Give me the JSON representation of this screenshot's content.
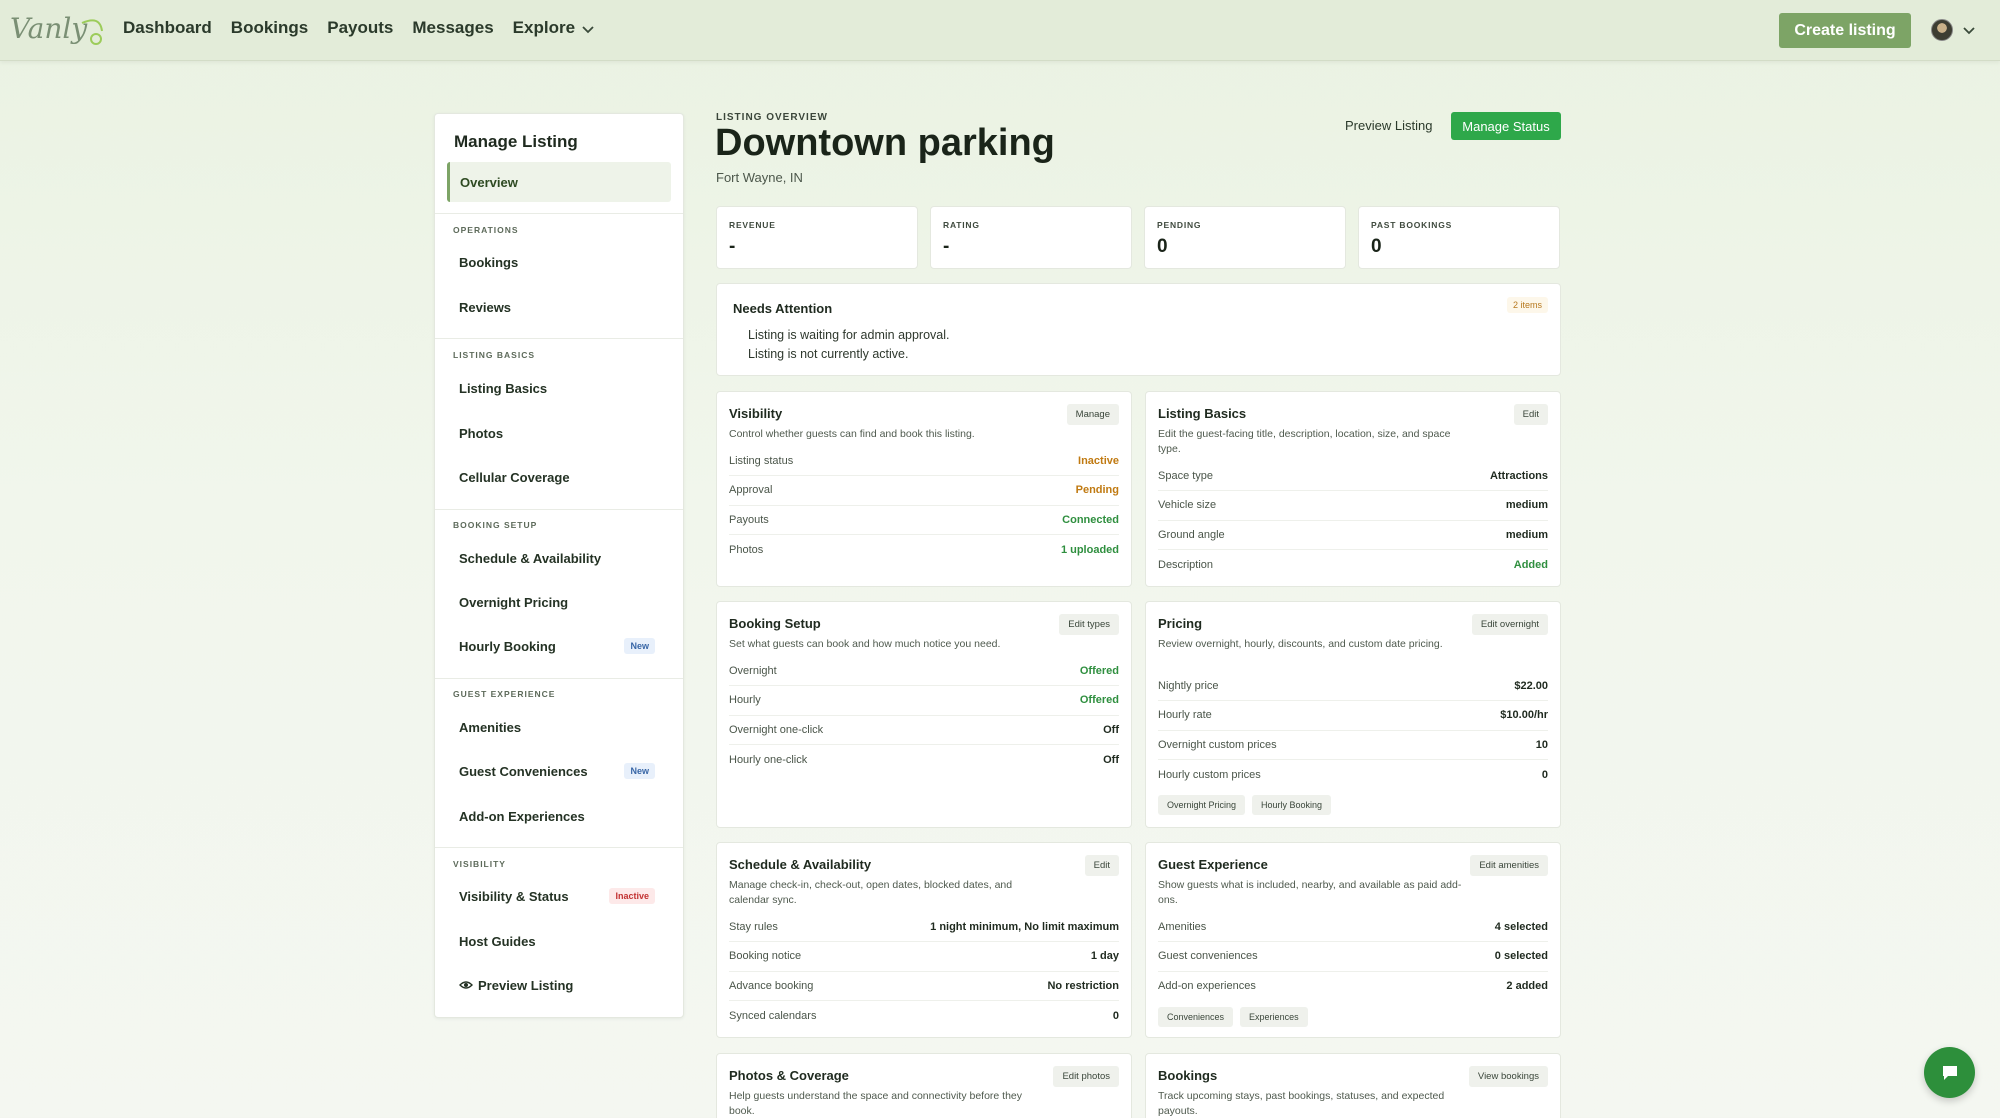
{
  "nav": {
    "brand": "Vanly",
    "links": [
      "Dashboard",
      "Bookings",
      "Payouts",
      "Messages",
      "Explore"
    ],
    "create_label": "Create listing"
  },
  "sidebar": {
    "title": "Manage Listing",
    "overview": "Overview",
    "sections": {
      "operations": "OPERATIONS",
      "listing_basics": "LISTING BASICS",
      "booking_setup": "BOOKING SETUP",
      "guest_experience": "GUEST EXPERIENCE",
      "visibility": "VISIBILITY"
    },
    "items": {
      "bookings": "Bookings",
      "reviews": "Reviews",
      "listing_basics": "Listing Basics",
      "photos": "Photos",
      "cellular": "Cellular Coverage",
      "schedule": "Schedule & Availability",
      "overnight": "Overnight Pricing",
      "hourly": "Hourly Booking",
      "amenities": "Amenities",
      "conveniences": "Guest Conveniences",
      "addons": "Add-on Experiences",
      "visibility_status": "Visibility & Status",
      "host_guides": "Host Guides",
      "preview": "Preview Listing"
    },
    "badges": {
      "new": "New",
      "inactive": "Inactive"
    }
  },
  "header": {
    "eyebrow": "LISTING OVERVIEW",
    "title": "Downtown parking",
    "location": "Fort Wayne, IN",
    "preview_label": "Preview Listing",
    "manage_status_label": "Manage Status"
  },
  "stats": [
    {
      "label": "REVENUE",
      "value": "-"
    },
    {
      "label": "RATING",
      "value": "-"
    },
    {
      "label": "PENDING",
      "value": "0"
    },
    {
      "label": "PAST BOOKINGS",
      "value": "0"
    }
  ],
  "attention": {
    "title": "Needs Attention",
    "badge": "2 items",
    "items": [
      "Listing is waiting for admin approval.",
      "Listing is not currently active."
    ]
  },
  "cards": {
    "visibility": {
      "title": "Visibility",
      "button": "Manage",
      "desc": "Control whether guests can find and book this listing.",
      "rows": [
        [
          "Listing status",
          "Inactive"
        ],
        [
          "Approval",
          "Pending"
        ],
        [
          "Payouts",
          "Connected"
        ],
        [
          "Photos",
          "1 uploaded"
        ]
      ]
    },
    "listing_basics": {
      "title": "Listing Basics",
      "button": "Edit",
      "desc": "Edit the guest-facing title, description, location, size, and space type.",
      "rows": [
        [
          "Space type",
          "Attractions"
        ],
        [
          "Vehicle size",
          "medium"
        ],
        [
          "Ground angle",
          "medium"
        ],
        [
          "Description",
          "Added"
        ]
      ]
    },
    "booking_setup": {
      "title": "Booking Setup",
      "button": "Edit types",
      "desc": "Set what guests can book and how much notice you need.",
      "rows": [
        [
          "Overnight",
          "Offered"
        ],
        [
          "Hourly",
          "Offered"
        ],
        [
          "Overnight one-click",
          "Off"
        ],
        [
          "Hourly one-click",
          "Off"
        ]
      ]
    },
    "pricing": {
      "title": "Pricing",
      "button": "Edit overnight",
      "desc": "Review overnight, hourly, discounts, and custom date pricing.",
      "rows": [
        [
          "Nightly price",
          "$22.00"
        ],
        [
          "Hourly rate",
          "$10.00/hr"
        ],
        [
          "Overnight custom prices",
          "10"
        ],
        [
          "Hourly custom prices",
          "0"
        ]
      ],
      "chips": [
        "Overnight Pricing",
        "Hourly Booking"
      ]
    },
    "schedule": {
      "title": "Schedule & Availability",
      "button": "Edit",
      "desc": "Manage check-in, check-out, open dates, blocked dates, and calendar sync.",
      "rows": [
        [
          "Stay rules",
          "1 night minimum, No limit maximum"
        ],
        [
          "Booking notice",
          "1 day"
        ],
        [
          "Advance booking",
          "No restriction"
        ],
        [
          "Synced calendars",
          "0"
        ]
      ]
    },
    "guest_experience": {
      "title": "Guest Experience",
      "button": "Edit amenities",
      "desc": "Show guests what is included, nearby, and available as paid add-ons.",
      "rows": [
        [
          "Amenities",
          "4 selected"
        ],
        [
          "Guest conveniences",
          "0 selected"
        ],
        [
          "Add-on experiences",
          "2 added"
        ]
      ],
      "chips": [
        "Conveniences",
        "Experiences"
      ]
    },
    "photos_coverage": {
      "title": "Photos & Coverage",
      "button": "Edit photos",
      "desc": "Help guests understand the space and connectivity before they book."
    },
    "bookings": {
      "title": "Bookings",
      "button": "View bookings",
      "desc": "Track upcoming stays, past bookings, statuses, and expected payouts."
    }
  },
  "colors": {
    "brand": "#7da466",
    "primary": "#2ea84a",
    "positive": "#2f8f3f",
    "warning": "#c07a12",
    "danger": "#c23232"
  },
  "icons": [
    "logo",
    "chevron-down-icon",
    "avatar",
    "eye-icon",
    "chat-icon"
  ]
}
